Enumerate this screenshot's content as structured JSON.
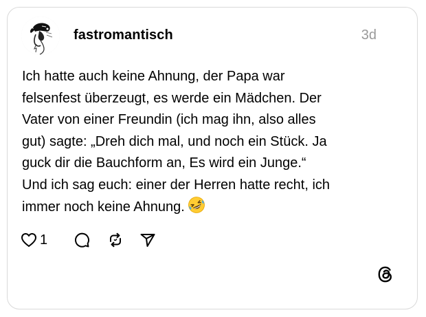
{
  "post": {
    "username": "fastromantisch",
    "timestamp": "3d",
    "text_lines": [
      "Ich hatte auch keine Ahnung, der Papa war",
      "felsenfest überzeugt, es werde ein Mädchen. Der",
      "Vater von einer Freundin (ich mag ihn, also alles",
      "gut) sagte: „Dreh dich mal, und noch ein Stück. Ja",
      "guck dir die Bauchform an, Es wird ein Junge.“",
      "Und ich sag euch: einer der Herren hatte recht, ich",
      "immer noch keine Ahnung."
    ],
    "emoji": "rolling-on-the-floor-laughing",
    "like_count": "1"
  },
  "icons": {
    "avatar": "avatar-sketch",
    "like": "heart-icon",
    "reply": "comment-bubble-icon",
    "repost": "repost-icon",
    "share": "send-icon",
    "brand": "threads-logo-icon"
  },
  "colors": {
    "timestamp": "#999999",
    "border": "#d9d9d9",
    "emoji_face": "#FFCC33",
    "emoji_tears": "#3FA9F5"
  }
}
